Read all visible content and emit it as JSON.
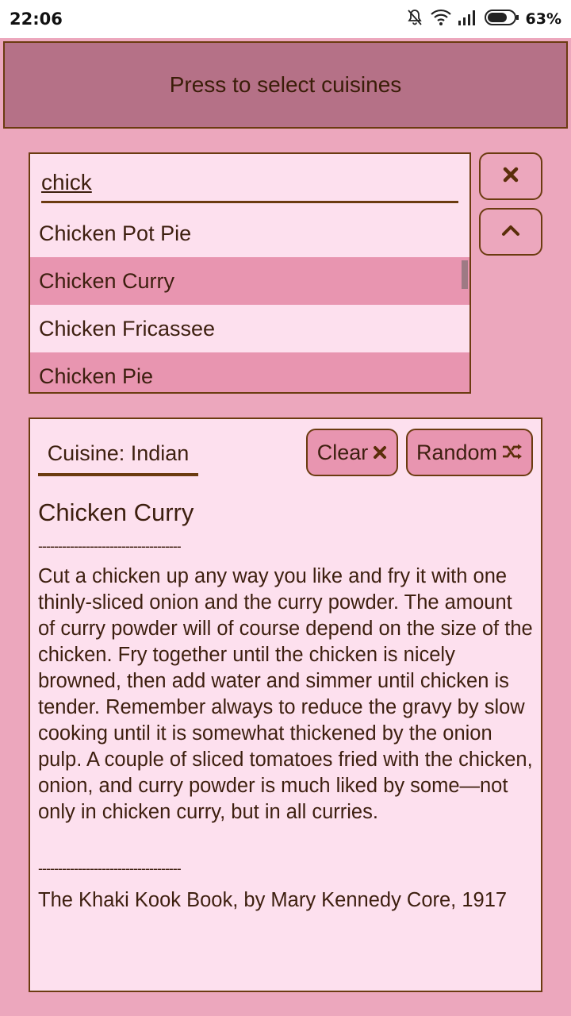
{
  "status_bar": {
    "time": "22:06",
    "battery": "63%",
    "icons": [
      "notifications-off-icon",
      "wifi-icon",
      "signal-icon",
      "battery-icon"
    ]
  },
  "cuisine_selector": {
    "label": "Press to select cuisines"
  },
  "search": {
    "value": "chick",
    "suggestions": [
      "Chicken Pot Pie",
      "Chicken Curry",
      "Chicken Fricassee",
      "Chicken Pie"
    ]
  },
  "side_buttons": {
    "clear_icon": "close-icon",
    "collapse_icon": "chevron-up-icon"
  },
  "recipe": {
    "cuisine_label": "Cuisine: Indian",
    "clear_label": "Clear",
    "random_label": "Random",
    "title": "Chicken Curry",
    "divider": "------------------------------------",
    "body": "Cut a chicken up any way you like and fry it with one thinly-sliced onion and the curry powder. The amount of curry powder will of course depend on the size of the chicken. Fry together until the chicken is nicely browned, then add water and simmer until chicken is tender. Remember always to reduce the gravy by slow cooking until it is somewhat thickened by the onion pulp. A couple of sliced tomatoes fried with the chicken, onion, and curry powder is much liked by some—not only in chicken curry, but in all curries.",
    "source": "The Khaki Kook Book, by Mary Kennedy Core, 1917"
  },
  "colors": {
    "background": "#eca7bd",
    "header": "#b57187",
    "panel": "#fde0ee",
    "highlight": "#e895b0",
    "border": "#6b3b10"
  }
}
